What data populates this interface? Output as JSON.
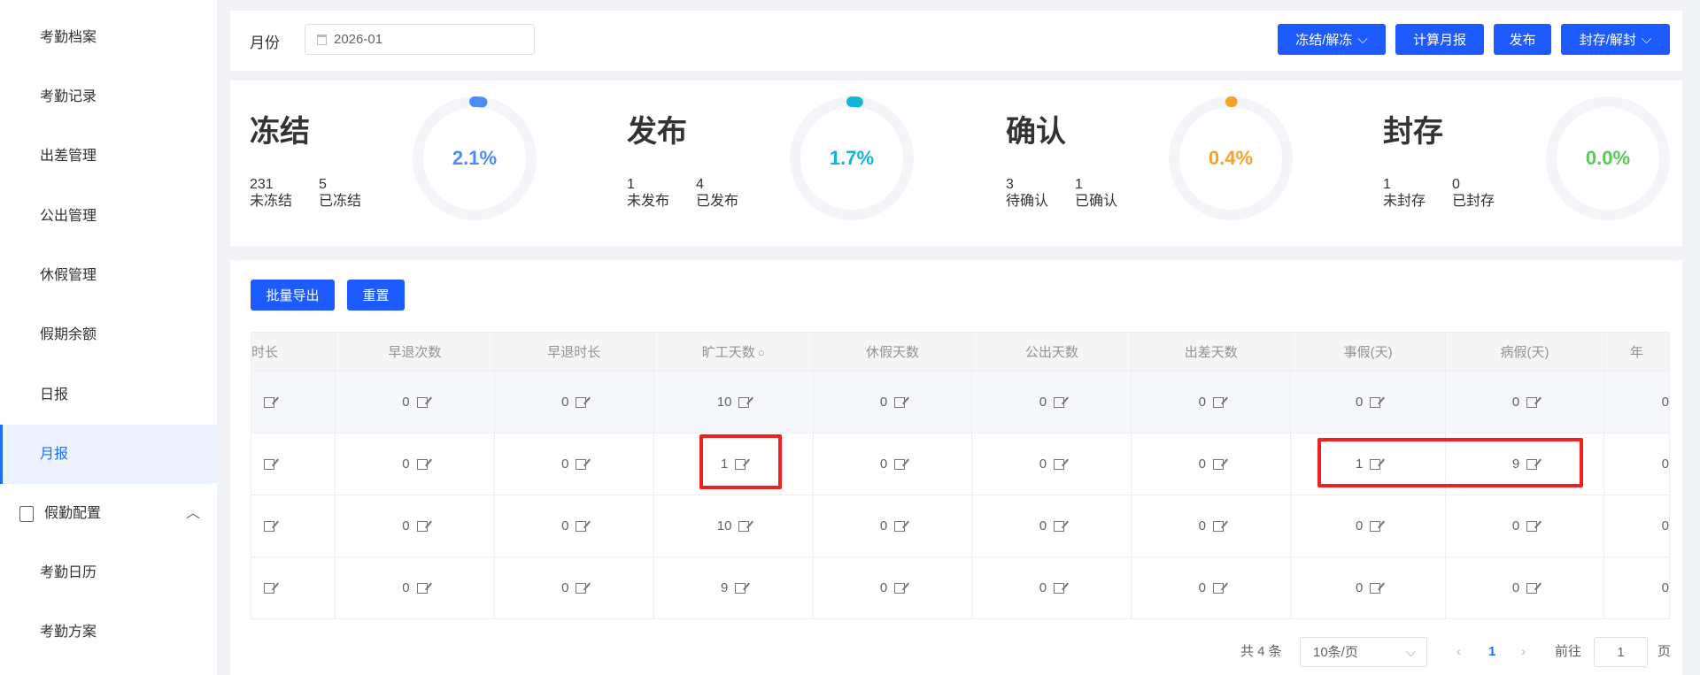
{
  "sidebar": {
    "items": [
      "考勤档案",
      "考勤记录",
      "出差管理",
      "公出管理",
      "休假管理",
      "假期余额",
      "日报",
      "月报"
    ],
    "active": "月报",
    "group": "假勤配置",
    "sub_items": [
      "考勤日历",
      "考勤方案"
    ]
  },
  "toolbar": {
    "month_label": "月份",
    "month_value": "2026-01",
    "buttons": [
      "冻结/解冻",
      "计算月报",
      "发布",
      "封存/解封"
    ]
  },
  "stats": [
    {
      "title": "冻结",
      "a_num": "231",
      "a_label": "未冻结",
      "b_num": "5",
      "b_label": "已冻结",
      "pct": "2.1%",
      "value": 2.1,
      "color": "#4e8cf5"
    },
    {
      "title": "发布",
      "a_num": "1",
      "a_label": "未发布",
      "b_num": "4",
      "b_label": "已发布",
      "pct": "1.7%",
      "value": 1.7,
      "color": "#13b5d6"
    },
    {
      "title": "确认",
      "a_num": "3",
      "a_label": "待确认",
      "b_num": "1",
      "b_label": "已确认",
      "pct": "0.4%",
      "value": 0.4,
      "color": "#f7a12a"
    },
    {
      "title": "封存",
      "a_num": "1",
      "a_label": "未封存",
      "b_num": "0",
      "b_label": "已封存",
      "pct": "0.0%",
      "value": 0.0,
      "color": "#5ac85a"
    }
  ],
  "actions": {
    "export": "批量导出",
    "reset": "重置"
  },
  "table": {
    "headers": [
      "时长",
      "早退次数",
      "早退时长",
      "旷工天数",
      "休假天数",
      "公出天数",
      "出差天数",
      "事假(天)",
      "病假(天)",
      "年"
    ],
    "rows": [
      [
        "",
        "0",
        "0",
        "10",
        "0",
        "0",
        "0",
        "0",
        "0",
        "0"
      ],
      [
        "",
        "0",
        "0",
        "1",
        "0",
        "0",
        "0",
        "1",
        "9",
        "0"
      ],
      [
        "",
        "0",
        "0",
        "10",
        "0",
        "0",
        "0",
        "0",
        "0",
        "0"
      ],
      [
        "",
        "0",
        "0",
        "9",
        "0",
        "0",
        "0",
        "0",
        "0",
        "0"
      ]
    ]
  },
  "pagination": {
    "total": "共 4 条",
    "page_size": "10条/页",
    "current": "1",
    "goto": "前往",
    "goto_value": "1",
    "page_unit": "页"
  }
}
